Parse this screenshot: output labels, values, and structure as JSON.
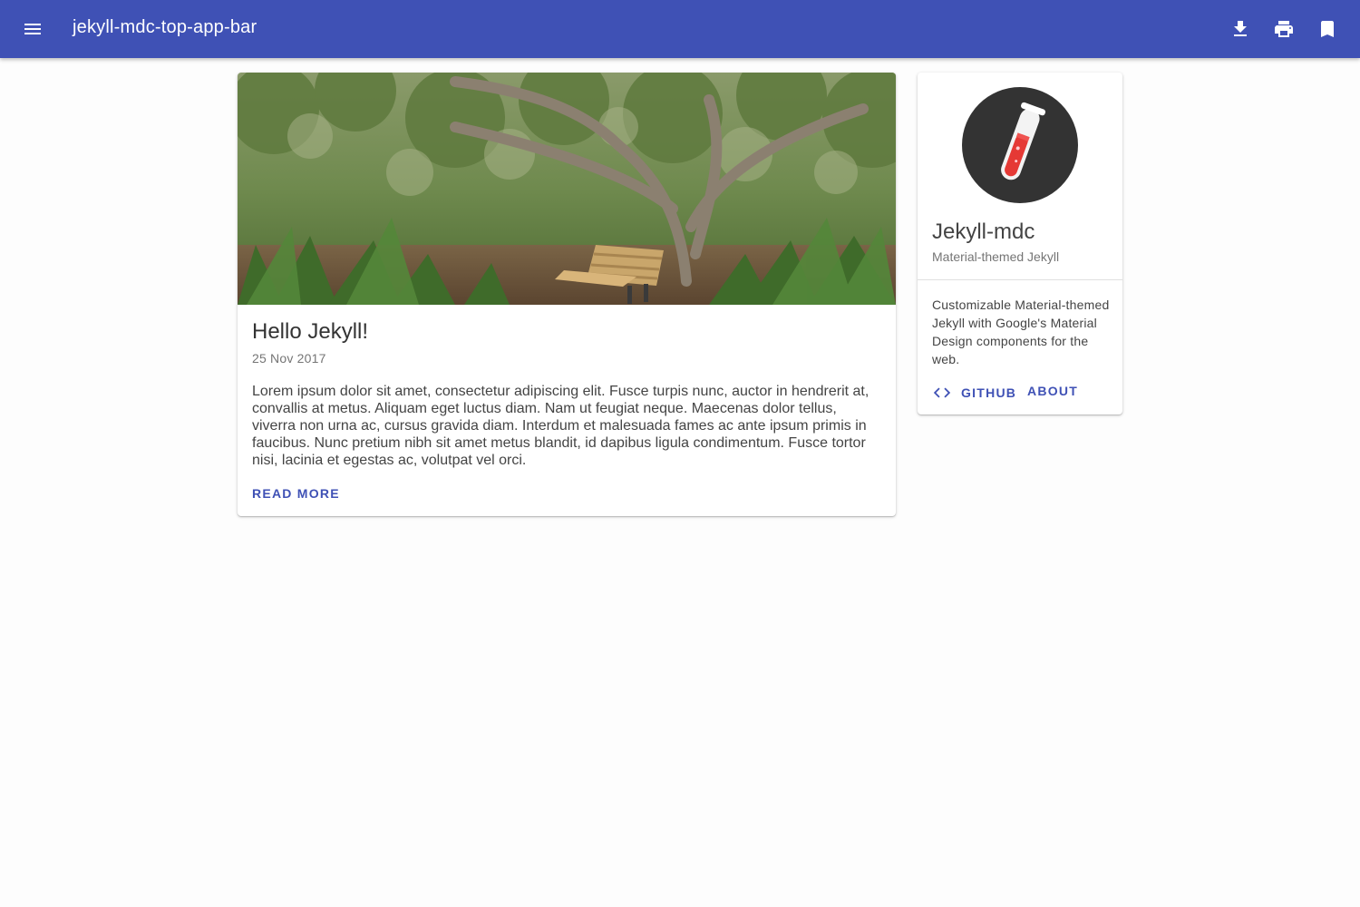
{
  "app_bar": {
    "title": "jekyll-mdc-top-app-bar",
    "background": "#3f51b5",
    "navigation_icon": "menu-icon",
    "actions": [
      {
        "icon": "download-icon"
      },
      {
        "icon": "print-icon"
      },
      {
        "icon": "bookmark-icon"
      }
    ]
  },
  "post": {
    "image_description": "forest-bench-photo",
    "title": "Hello Jekyll!",
    "date": "25 Nov 2017",
    "excerpt": "Lorem ipsum dolor sit amet, consectetur adipiscing elit. Fusce turpis nunc, auctor in hendrerit at, convallis at metus. Aliquam eget luctus diam. Nam ut feugiat neque. Maecenas dolor tellus, viverra non urna ac, cursus gravida diam. Interdum et malesuada fames ac ante ipsum primis in faucibus. Nunc pretium nibh sit amet metus blandit, id dapibus ligula condimentum. Fusce tortor nisi, lacinia et egestas ac, volutpat vel orci.",
    "read_more_label": "Read more"
  },
  "profile": {
    "avatar_icon": "test-tube-icon",
    "name": "Jekyll-mdc",
    "tagline": "Material-themed Jekyll",
    "description": "Customizable Material-themed Jekyll with Google's Material Design components for the web.",
    "github_label": "GitHub",
    "github_icon": "code-icon",
    "about_label": "About"
  },
  "colors": {
    "primary": "#3f51b5",
    "surface": "#ffffff",
    "background": "#fdfdfd"
  }
}
